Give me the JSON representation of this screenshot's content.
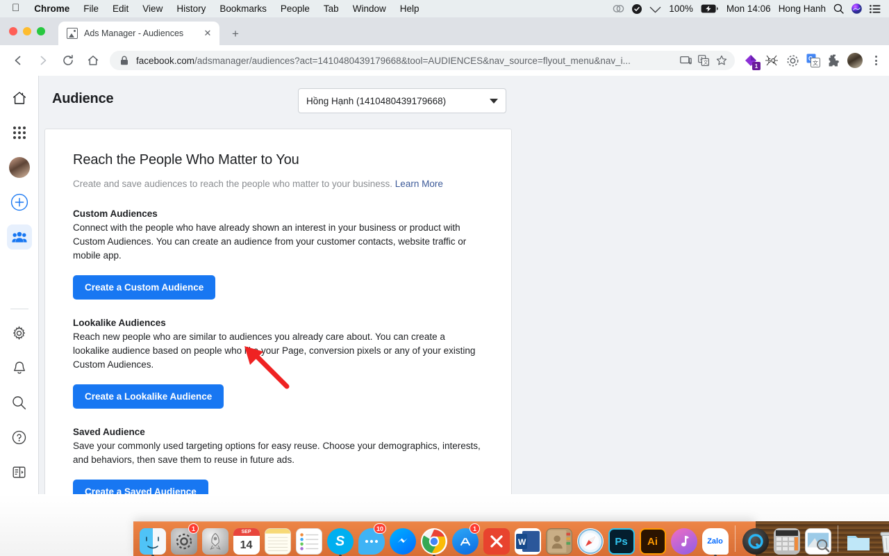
{
  "menubar": {
    "apple_icon": "apple-logo-icon",
    "items": [
      {
        "label": "Chrome",
        "bold": true
      },
      {
        "label": "File",
        "bold": false
      },
      {
        "label": "Edit",
        "bold": false
      },
      {
        "label": "View",
        "bold": false
      },
      {
        "label": "History",
        "bold": false
      },
      {
        "label": "Bookmarks",
        "bold": false
      },
      {
        "label": "People",
        "bold": false
      },
      {
        "label": "Tab",
        "bold": false
      },
      {
        "label": "Window",
        "bold": false
      },
      {
        "label": "Help",
        "bold": false
      }
    ],
    "status": {
      "creative_cloud_icon": "creative-cloud-icon",
      "dropbox_icon": "checkmark-circle-icon",
      "wifi_icon": "wifi-icon",
      "battery_percent": "100%",
      "battery_icon": "battery-charging-icon",
      "clock": "Mon 14:06",
      "user": "Hong Hanh",
      "search_icon": "spotlight-search-icon",
      "siri_icon": "siri-icon",
      "control_center_icon": "notification-center-icon"
    }
  },
  "browser": {
    "tab": {
      "title": "Ads Manager - Audiences",
      "favicon": "ads-manager-favicon",
      "close_icon": "close-icon"
    },
    "new_tab_icon": "plus-icon",
    "nav": {
      "back_icon": "arrow-back-icon",
      "forward_icon": "arrow-forward-icon",
      "reload_icon": "reload-icon",
      "home_icon": "home-icon"
    },
    "omnibox": {
      "lock_icon": "lock-icon",
      "url_domain": "facebook.com",
      "url_path": "/adsmanager/audiences?act=1410480439179668&tool=AUDIENCES&nav_source=flyout_menu&nav_i...",
      "cast_icon": "cast-icon",
      "translate_icon": "translate-icon",
      "bookmark_icon": "star-icon"
    },
    "extensions": [
      {
        "name": "purple-diamond-extension-icon",
        "badge": "1"
      },
      {
        "name": "seo-quake-extension-icon",
        "badge": ""
      },
      {
        "name": "gear-extension-icon",
        "badge": ""
      },
      {
        "name": "google-translate-extension-icon",
        "badge": ""
      },
      {
        "name": "puzzle-extensions-icon",
        "badge": ""
      }
    ],
    "profile_avatar": "profile-avatar",
    "menu_icon": "three-dot-menu-icon"
  },
  "sidebar": {
    "top_items": [
      {
        "name": "home-icon",
        "label": "Home",
        "active": false
      },
      {
        "name": "apps-grid-icon",
        "label": "All tools",
        "active": false
      },
      {
        "name": "account-avatar",
        "label": "Account",
        "active": false
      },
      {
        "name": "plus-circle-icon",
        "label": "Create",
        "active": false
      },
      {
        "name": "audiences-people-icon",
        "label": "Audiences",
        "active": true
      }
    ],
    "bottom_items": [
      {
        "name": "gear-icon",
        "label": "Settings"
      },
      {
        "name": "bell-icon",
        "label": "Notifications"
      },
      {
        "name": "search-icon",
        "label": "Search"
      },
      {
        "name": "help-circle-icon",
        "label": "Help"
      },
      {
        "name": "collapse-panel-icon",
        "label": "Collapse panel"
      }
    ]
  },
  "page": {
    "title": "Audience",
    "account_selector": {
      "value": "Hồng Hạnh (1410480439179668)",
      "caret_icon": "chevron-down-icon"
    },
    "card": {
      "heading": "Reach the People Who Matter to You",
      "lede": "Create and save audiences to reach the people who matter to your business.",
      "lede_link": "Learn More",
      "sections": [
        {
          "title": "Custom Audiences",
          "body": "Connect with the people who have already shown an interest in your business or product with Custom Audiences. You can create an audience from your customer contacts, website traffic or mobile app.",
          "button": "Create a Custom Audience"
        },
        {
          "title": "Lookalike Audiences",
          "body": "Reach new people who are similar to audiences you already care about. You can create a lookalike audience based on people who like your Page, conversion pixels or any of your existing Custom Audiences.",
          "button": "Create a Lookalike Audience"
        },
        {
          "title": "Saved Audience",
          "body": "Save your commonly used targeting options for easy reuse. Choose your demographics, interests, and behaviors, then save them to reuse in future ads.",
          "button": "Create a Saved Audience"
        }
      ]
    },
    "annotation": {
      "name": "red-arrow-annotation",
      "color": "#ef2222",
      "points_to": "Create a Custom Audience"
    }
  },
  "dock": {
    "apps": [
      {
        "name": "finder-icon",
        "label": "Finder",
        "badge": "",
        "running": true
      },
      {
        "name": "system-preferences-icon",
        "label": "System Preferences",
        "badge": "1",
        "running": false
      },
      {
        "name": "launchpad-icon",
        "label": "Launchpad",
        "badge": "",
        "running": false
      },
      {
        "name": "calendar-icon",
        "label": "Calendar",
        "badge": "",
        "running": false,
        "month": "SEP",
        "day": "14"
      },
      {
        "name": "notes-icon",
        "label": "Notes",
        "badge": "",
        "running": false
      },
      {
        "name": "reminders-icon",
        "label": "Reminders",
        "badge": "",
        "running": false
      },
      {
        "name": "skype-icon",
        "label": "Skype",
        "badge": "",
        "running": true
      },
      {
        "name": "messages-icon",
        "label": "Messages",
        "badge": "10",
        "running": false
      },
      {
        "name": "messenger-icon",
        "label": "Messenger",
        "badge": "",
        "running": false
      },
      {
        "name": "chrome-icon",
        "label": "Google Chrome",
        "badge": "",
        "running": true
      },
      {
        "name": "app-store-icon",
        "label": "App Store",
        "badge": "1",
        "running": false
      },
      {
        "name": "xmind-icon",
        "label": "XMind",
        "badge": "",
        "running": false
      },
      {
        "name": "word-icon",
        "label": "Microsoft Word",
        "badge": "",
        "running": false
      },
      {
        "name": "contacts-icon",
        "label": "Contacts",
        "badge": "",
        "running": false
      },
      {
        "name": "safari-icon",
        "label": "Safari",
        "badge": "",
        "running": false
      },
      {
        "name": "photoshop-icon",
        "label": "Adobe Photoshop",
        "badge": "",
        "running": false
      },
      {
        "name": "illustrator-icon",
        "label": "Adobe Illustrator",
        "badge": "",
        "running": false
      },
      {
        "name": "itunes-icon",
        "label": "iTunes",
        "badge": "",
        "running": false
      },
      {
        "name": "zalo-icon",
        "label": "Zalo",
        "badge": "",
        "running": true
      }
    ],
    "utilities": [
      {
        "name": "quicktime-icon",
        "label": "QuickTime Player"
      },
      {
        "name": "calculator-icon",
        "label": "Calculator"
      },
      {
        "name": "preview-icon",
        "label": "Preview"
      }
    ],
    "trash_area": [
      {
        "name": "downloads-folder-icon",
        "label": "Downloads"
      },
      {
        "name": "trash-icon",
        "label": "Trash"
      }
    ]
  }
}
